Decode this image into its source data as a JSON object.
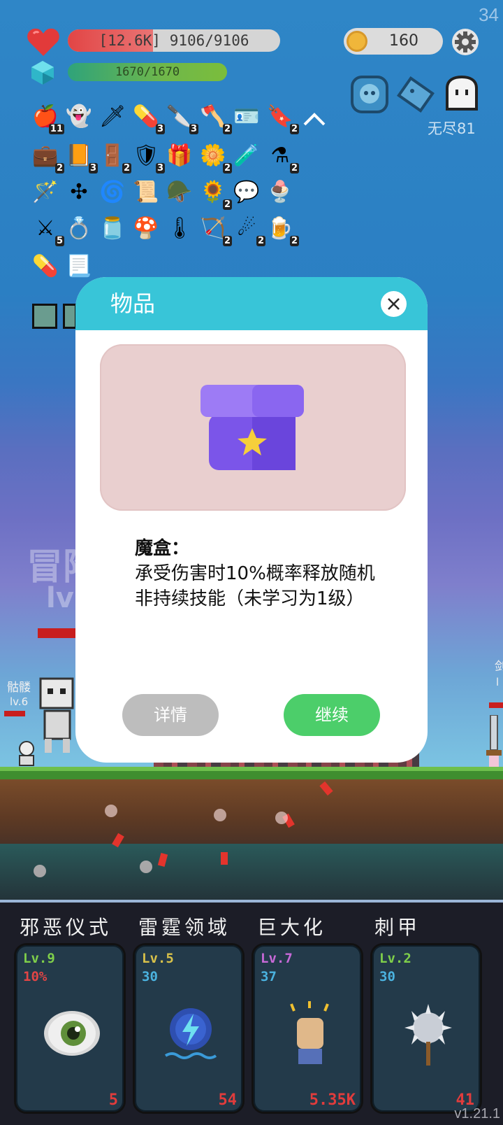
{
  "fps": "34",
  "hud": {
    "hp_damage": "[12.6K]",
    "hp_value": "9106/9106",
    "mp_value": "1670/1670",
    "gold": "160",
    "endless_stage": "无尽81"
  },
  "inventory": [
    {
      "icon": "apple-icon",
      "glyph": "🍎",
      "count": "11"
    },
    {
      "icon": "ghost-hand-icon",
      "glyph": "👻",
      "count": ""
    },
    {
      "icon": "dark-sword-icon",
      "glyph": "🗡",
      "count": ""
    },
    {
      "icon": "pill-icon",
      "glyph": "💊",
      "count": "3"
    },
    {
      "icon": "dagger-icon",
      "glyph": "🔪",
      "count": "3"
    },
    {
      "icon": "axe-icon",
      "glyph": "🪓",
      "count": "2"
    },
    {
      "icon": "card-icon",
      "glyph": "🪪",
      "count": ""
    },
    {
      "icon": "bookmark-icon",
      "glyph": "🔖",
      "count": "2"
    },
    {
      "icon": "briefcase-icon",
      "glyph": "💼",
      "count": "2"
    },
    {
      "icon": "book-icon",
      "glyph": "📙",
      "count": "3"
    },
    {
      "icon": "door-icon",
      "glyph": "🚪",
      "count": "2"
    },
    {
      "icon": "shield-icon",
      "glyph": "🛡",
      "count": "3"
    },
    {
      "icon": "magic-box-icon",
      "glyph": "🎁",
      "count": ""
    },
    {
      "icon": "flower-icon",
      "glyph": "🌼",
      "count": "2"
    },
    {
      "icon": "potion-icon",
      "glyph": "🧪",
      "count": ""
    },
    {
      "icon": "flask-icon",
      "glyph": "⚗",
      "count": "2"
    },
    {
      "icon": "wand-icon",
      "glyph": "🪄",
      "count": ""
    },
    {
      "icon": "dots-icon",
      "glyph": "✣",
      "count": ""
    },
    {
      "icon": "target-icon",
      "glyph": "🌀",
      "count": ""
    },
    {
      "icon": "scroll-icon",
      "glyph": "📜",
      "count": ""
    },
    {
      "icon": "helmet-icon",
      "glyph": "🪖",
      "count": ""
    },
    {
      "icon": "sunflower-icon",
      "glyph": "🌻",
      "count": "2"
    },
    {
      "icon": "chat-icon",
      "glyph": "💬",
      "count": ""
    },
    {
      "icon": "ice-cream-icon",
      "glyph": "🍨",
      "count": ""
    },
    {
      "icon": "sword-icon",
      "glyph": "⚔",
      "count": "5"
    },
    {
      "icon": "ring-icon",
      "glyph": "💍",
      "count": ""
    },
    {
      "icon": "jam-jar-icon",
      "glyph": "🫙",
      "count": ""
    },
    {
      "icon": "mushroom-icon",
      "glyph": "🍄",
      "count": ""
    },
    {
      "icon": "thermometer-icon",
      "glyph": "🌡",
      "count": ""
    },
    {
      "icon": "bow-icon",
      "glyph": "🏹",
      "count": "2"
    },
    {
      "icon": "meteor-icon",
      "glyph": "☄",
      "count": "2"
    },
    {
      "icon": "beer-icon",
      "glyph": "🍺",
      "count": "2"
    },
    {
      "icon": "capsule-icon",
      "glyph": "💊",
      "count": ""
    },
    {
      "icon": "paper-scroll-icon",
      "glyph": "📃",
      "count": ""
    }
  ],
  "battle": {
    "bg_text": "冒险",
    "bg_level": "lv",
    "enemy1_name": "骷髅",
    "enemy1_level": "lv.6",
    "right_enemy_name": "剑",
    "right_enemy_level": "l"
  },
  "modal": {
    "title": "物品",
    "item_name": "魔盒：",
    "item_description": "承受伤害时10%概率释放随机非持续技能（未学习为1级）",
    "detail_button": "详情",
    "continue_button": "继续"
  },
  "skills": [
    {
      "name": "邪恶仪式",
      "level": "Lv.9",
      "level_color": "#7fcf4a",
      "value": "10%",
      "value_color": "#e24545",
      "count": "5",
      "icon": "eye-icon"
    },
    {
      "name": "雷霆领域",
      "level": "Lv.5",
      "level_color": "#d9c24a",
      "value": "30",
      "value_color": "#4bb3e0",
      "count": "54",
      "icon": "lightning-gear-icon"
    },
    {
      "name": "巨大化",
      "level": "Lv.7",
      "level_color": "#c86ad8",
      "value": "37",
      "value_color": "#4bb3e0",
      "count": "5.35K",
      "icon": "fist-icon"
    },
    {
      "name": "刺甲",
      "level": "Lv.2",
      "level_color": "#7fcf4a",
      "value": "30",
      "value_color": "#4bb3e0",
      "count": "41",
      "icon": "spiked-mace-icon"
    }
  ],
  "version": "v1.21.1",
  "colors": {
    "modal_header": "#38c5d8",
    "continue_button": "#4cce6a",
    "detail_button": "#bdbdbd"
  }
}
